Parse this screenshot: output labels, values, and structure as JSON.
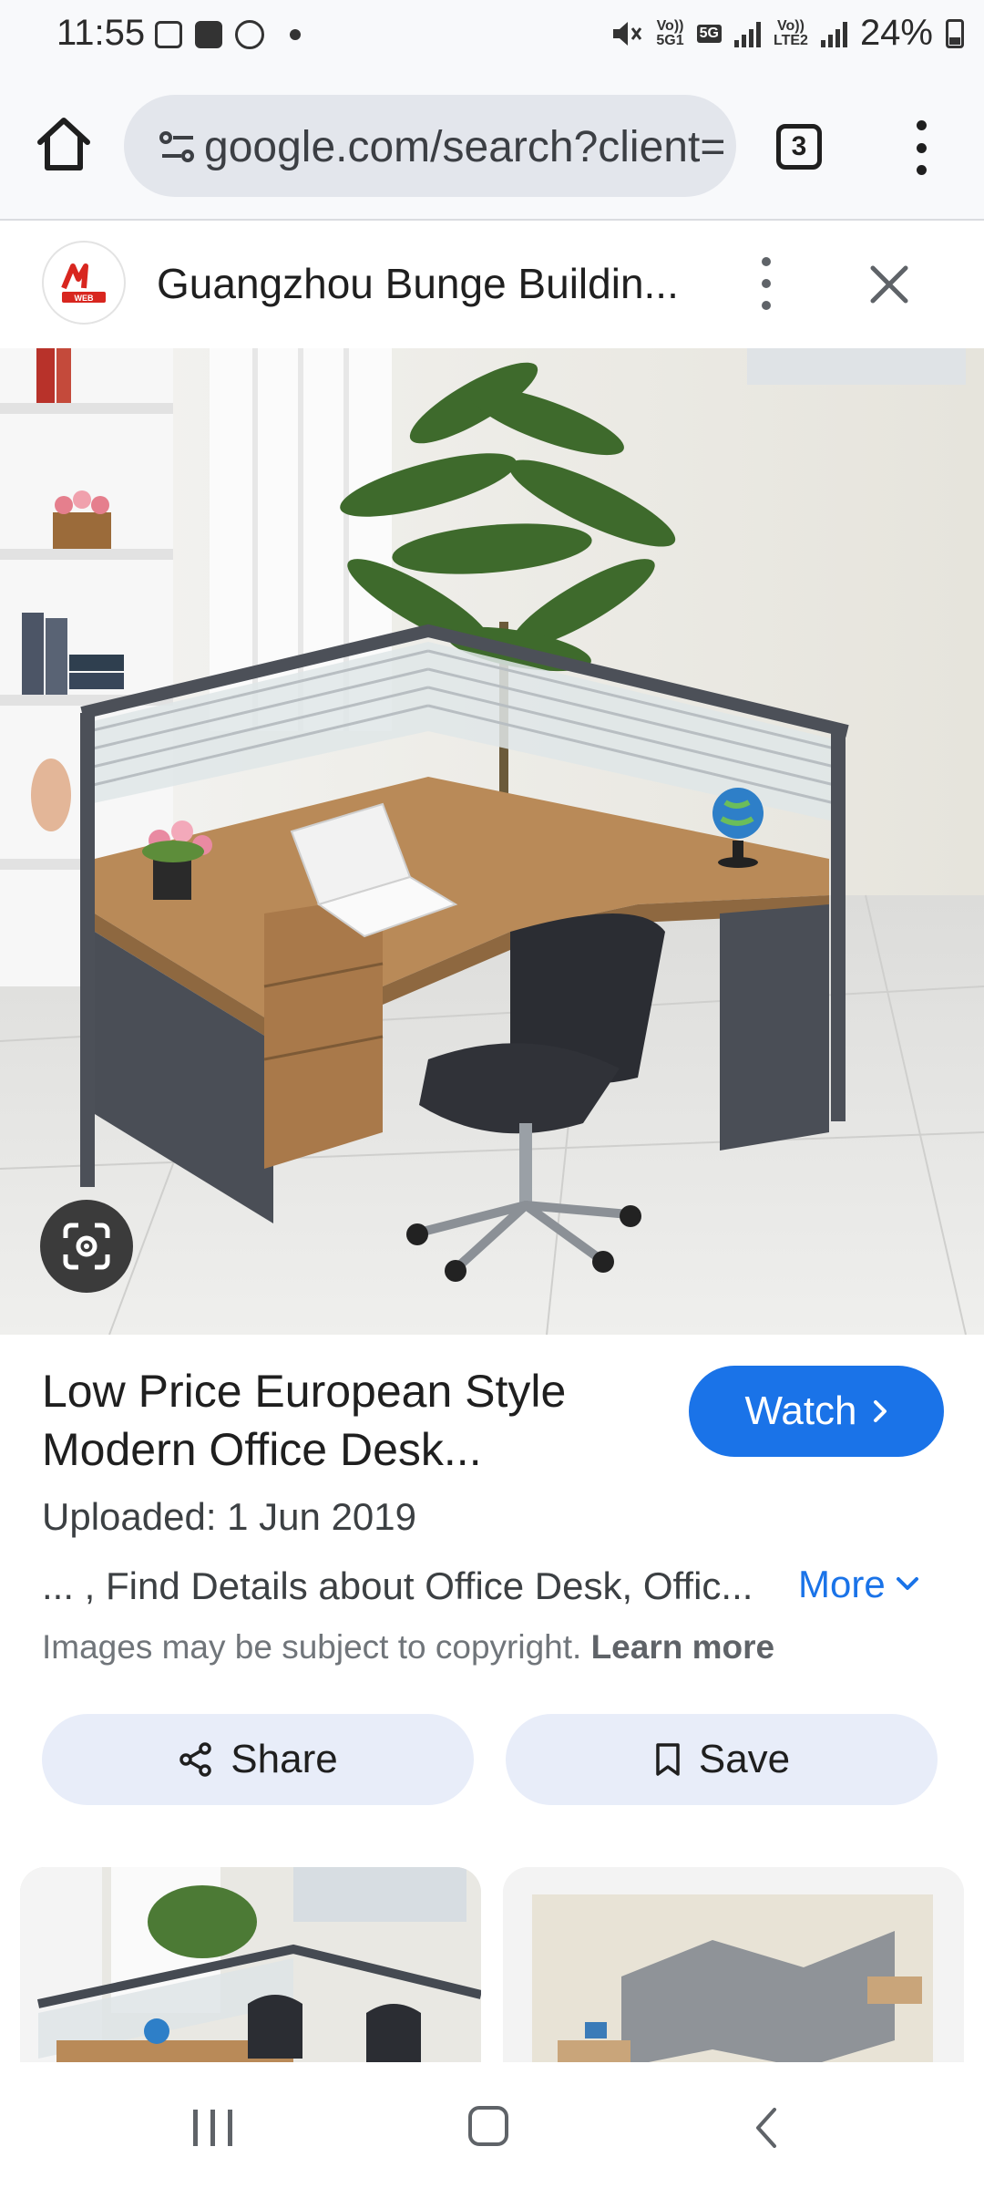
{
  "status_bar": {
    "time": "11:55",
    "net1_top": "Vo))",
    "net1_bottom": "5G1",
    "net_5g": "5G",
    "net2_top": "Vo))",
    "net2_bottom": "LTE2",
    "battery": "24%"
  },
  "browser": {
    "url": "google.com/search?client=",
    "tab_count": "3"
  },
  "source": {
    "title": "Guangzhou Bunge Buildin...",
    "logo_text": "WEB"
  },
  "result": {
    "title_line1": "Low Price European Style",
    "title_line2": "Modern Office Desk...",
    "watch_label": "Watch",
    "uploaded": "Uploaded: 1 Jun 2019",
    "snippet": "... , Find Details about Office Desk, Offic...",
    "more_label": "More",
    "copyright_text": "Images may be subject to copyright.",
    "learn_more": "Learn more",
    "share_label": "Share",
    "save_label": "Save"
  }
}
